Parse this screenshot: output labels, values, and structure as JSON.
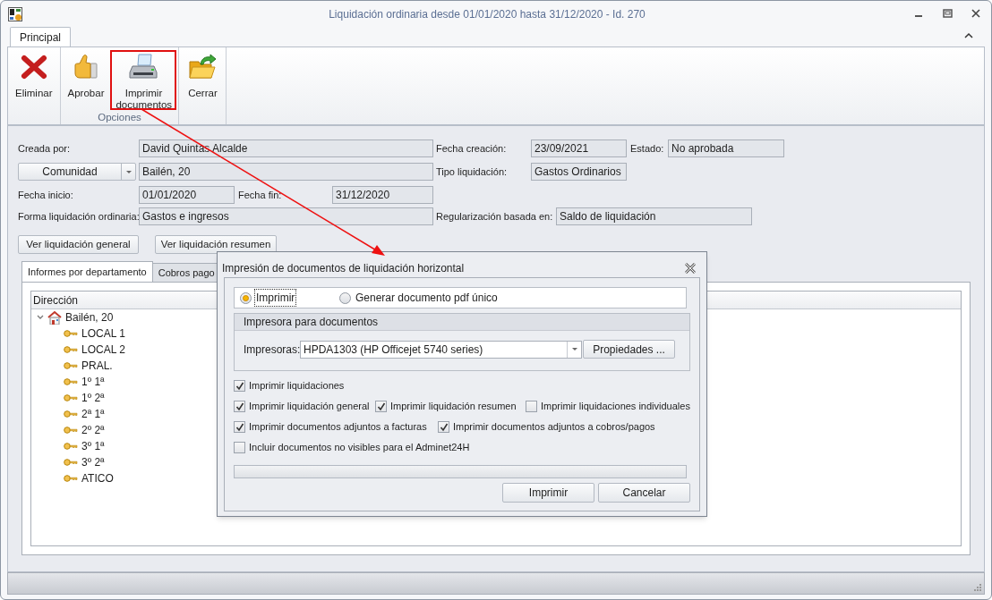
{
  "window": {
    "title": "Liquidación ordinaria desde 01/01/2020 hasta 31/12/2020 - Id. 270"
  },
  "ribbon": {
    "tabs": [
      {
        "label": "Principal",
        "selected": true
      }
    ],
    "groups": [
      {
        "buttons": [
          {
            "label": "Eliminar",
            "kind": "delete",
            "highlighted": false
          }
        ]
      },
      {
        "label": "Opciones",
        "buttons": [
          {
            "label": "Aprobar",
            "kind": "approve",
            "highlighted": false
          },
          {
            "label": "Imprimir documentos",
            "kind": "print",
            "highlighted": true
          }
        ]
      },
      {
        "buttons": [
          {
            "label": "Cerrar",
            "kind": "close",
            "highlighted": false
          }
        ]
      }
    ]
  },
  "form": {
    "rows": [
      [
        {
          "kind": "label",
          "text": "Creada por:"
        },
        {
          "kind": "field",
          "value": "David Quintas Alcalde"
        },
        {
          "kind": "label",
          "text": "Fecha creación:"
        },
        {
          "kind": "field",
          "value": "23/09/2021"
        },
        {
          "kind": "label",
          "text": "Estado:"
        },
        {
          "kind": "field",
          "value": "No aprobada"
        }
      ],
      [
        {
          "kind": "dropdown",
          "text": "Comunidad"
        },
        {
          "kind": "field",
          "value": "Bailén, 20"
        },
        {
          "kind": "label",
          "text": "Tipo liquidación:"
        },
        {
          "kind": "field",
          "value": "Gastos Ordinarios"
        }
      ],
      [
        {
          "kind": "label",
          "text": "Fecha inicio:"
        },
        {
          "kind": "field",
          "value": "01/01/2020"
        },
        {
          "kind": "label",
          "text": "Fecha fin:"
        },
        {
          "kind": "field",
          "value": "31/12/2020"
        }
      ],
      [
        {
          "kind": "label",
          "text": "Forma liquidación ordinaria:"
        },
        {
          "kind": "field",
          "value": "Gastos e ingresos"
        },
        {
          "kind": "label",
          "text": "Regularización basada en:"
        },
        {
          "kind": "field",
          "value": "Saldo de liquidación"
        }
      ]
    ]
  },
  "buttons": [
    "Ver liquidación general",
    "Ver liquidación resumen"
  ],
  "tabs": [
    {
      "label": "Informes por departamento",
      "selected": true
    },
    {
      "label": "Cobros pago",
      "selected": false
    }
  ],
  "tree": {
    "column": "Dirección",
    "nodes": [
      {
        "label": "Bailén, 20",
        "kind": "building",
        "expanded": true,
        "children": [
          {
            "label": "LOCAL 1",
            "kind": "unit"
          },
          {
            "label": "LOCAL 2",
            "kind": "unit"
          },
          {
            "label": "PRAL.",
            "kind": "unit"
          },
          {
            "label": "1º 1ª",
            "kind": "unit"
          },
          {
            "label": "1º 2ª",
            "kind": "unit"
          },
          {
            "label": "2ª 1ª",
            "kind": "unit"
          },
          {
            "label": "2º 2ª",
            "kind": "unit"
          },
          {
            "label": "3º 1ª",
            "kind": "unit"
          },
          {
            "label": "3º 2ª",
            "kind": "unit"
          },
          {
            "label": "ATICO",
            "kind": "unit"
          }
        ]
      }
    ]
  },
  "dialog": {
    "title": "Impresión de documentos de liquidación horizontal",
    "output_options": [
      {
        "label": "Imprimir",
        "selected": true,
        "focused": true
      },
      {
        "label": "Generar documento pdf único",
        "selected": false,
        "focused": false
      }
    ],
    "printer_group": {
      "title": "Impresora para documentos",
      "label": "Impresoras:",
      "value": "HPDA1303 (HP Officejet 5740 series)",
      "button": "Propiedades ..."
    },
    "checkbox_rows": [
      [
        {
          "label": "Imprimir liquidaciones",
          "checked": true
        }
      ],
      [
        {
          "label": "Imprimir liquidación general",
          "checked": true
        },
        {
          "label": "Imprimir liquidación resumen",
          "checked": true
        },
        {
          "label": "Imprimir liquidaciones individuales",
          "checked": false
        }
      ],
      [
        {
          "label": "Imprimir documentos adjuntos a facturas",
          "checked": true
        },
        {
          "label": "Imprimir documentos adjuntos a cobros/pagos",
          "checked": true
        }
      ],
      [
        {
          "label": "Incluir documentos no visibles para el Adminet24H",
          "checked": false
        }
      ]
    ],
    "progress": {
      "level": 0
    },
    "buttons": [
      "Imprimir",
      "Cancelar"
    ]
  }
}
